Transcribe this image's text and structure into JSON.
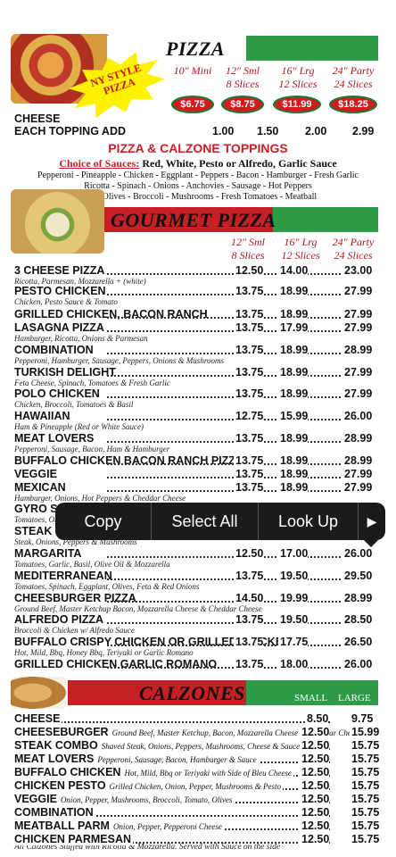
{
  "pizza": {
    "title": "PIZZA",
    "badge": "NY STYLE\nPIZZA",
    "sizes": [
      "10\" Mini",
      "12\" Sml\n8 Slices",
      "16\" Lrg\n12 Slices",
      "24\" Party\n24 Slices"
    ],
    "prices": [
      "$6.75",
      "$8.75",
      "$11.99",
      "$18.25"
    ],
    "cheese_label": "CHEESE",
    "topping_row": {
      "label": "EACH TOPPING ADD",
      "p1": "1.00",
      "p2": "1.50",
      "p3": "2.00",
      "p4": "2.99"
    }
  },
  "toppings": {
    "title": "PIZZA & CALZONE TOPPINGS",
    "sauces_label": "Choice of Sauces:",
    "sauces": "Red, White, Pesto or Alfredo, Garlic Sauce",
    "line1": "Pepperoni - Pineapple - Chicken - Eggplant - Peppers - Bacon - Hamburger - Fresh Garlic",
    "line2": "Ricotta - Spinach - Onions - Anchovies - Sausage - Hot Peppers",
    "line3": "Black Olives - Broccoli - Mushrooms - Fresh Tomatoes - Meatball"
  },
  "gourmet": {
    "title": "GOURMET PIZZA",
    "sizes": [
      "12\" Sml\n8 Slices",
      "16\" Lrg\n12 Slices",
      "24\" Party\n24 Slices"
    ],
    "items": [
      {
        "name": "3 CHEESE PIZZA",
        "desc": "Ricotta, Parmesan, Mozzarella + (white)",
        "p": [
          "12.50",
          "14.00",
          "23.00"
        ]
      },
      {
        "name": "PESTO CHICKEN",
        "desc": "Chicken, Pesto Sauce & Tomato",
        "p": [
          "13.75",
          "18.99",
          "27.99"
        ]
      },
      {
        "name": "GRILLED CHICKEN, BACON RANCH",
        "desc": "",
        "p": [
          "13.75",
          "18.99",
          "27.99"
        ]
      },
      {
        "name": "LASAGNA PIZZA",
        "desc": "Hamburger, Ricotta, Onions & Parmesan",
        "p": [
          "13.75",
          "17.99",
          "27.99"
        ]
      },
      {
        "name": "COMBINATION",
        "desc": "Pepperoni, Hamburger, Sausage, Peppers, Onions & Mushrooms",
        "p": [
          "13.75",
          "18.99",
          "28.99"
        ]
      },
      {
        "name": "TURKISH DELIGHT",
        "desc": "Feta Cheese, Spinach, Tomatoes & Fresh Garlic",
        "p": [
          "13.75",
          "18.99",
          "27.99"
        ]
      },
      {
        "name": "POLO CHICKEN",
        "desc": "Chicken, Broccoli, Tomatoes & Basil",
        "p": [
          "13.75",
          "18.99",
          "27.99"
        ]
      },
      {
        "name": "HAWAIIAN",
        "desc": "Ham & Pineapple (Red or White Sauce)",
        "p": [
          "12.75",
          "15.99",
          "26.00"
        ]
      },
      {
        "name": "MEAT LOVERS",
        "desc": "Pepperoni, Sausage, Bacon, Ham & Hamburger",
        "p": [
          "13.75",
          "18.99",
          "28.99"
        ]
      },
      {
        "name": "BUFFALO CHICKEN BACON RANCH PIZZA",
        "desc": "",
        "p": [
          "13.75",
          "18.99",
          "28.99"
        ]
      },
      {
        "name": "VEGGIE",
        "desc": "",
        "p": [
          "13.75",
          "18.99",
          "27.99"
        ]
      },
      {
        "name": "MEXICAN",
        "desc": "Hamburger, Onions, Hot Peppers & Cheddar Cheese",
        "p": [
          "13.75",
          "18.99",
          "27.99"
        ]
      },
      {
        "name": "GYRO SP",
        "desc": "Tomatoes, On",
        "p": [
          "",
          "",
          ""
        ]
      },
      {
        "name": "STEAK C",
        "desc": "Steak, Onions, Peppers & Mushrooms",
        "p": [
          "",
          "",
          "26.00"
        ]
      },
      {
        "name": "MARGARITA",
        "desc": "Tomatoes, Garlic, Basil, Olive Oil & Mozzarella",
        "p": [
          "12.50",
          "17.00",
          "26.00"
        ]
      },
      {
        "name": "MEDITERRANEAN",
        "desc": "Tomatoes, Spinach, Eggplant, Olives, Feta & Red Onions",
        "p": [
          "13.75",
          "19.50",
          "29.50"
        ]
      },
      {
        "name": "CHEESBURGER PIZZA",
        "desc": "Ground Beef, Master Ketchup Bacon, Mozzarella Cheese & Cheddar Cheese",
        "p": [
          "14.50",
          "19.99",
          "28.99"
        ]
      },
      {
        "name": "ALFREDO PIZZA",
        "desc": "Broccoli & Chicken w/ Alfredo Sauce",
        "p": [
          "13.75",
          "19.50",
          "28.50"
        ]
      },
      {
        "name": "BUFFALO CRISPY CHICKEN OR GRILLED CHICKEN",
        "desc": "Hot, Mild, Bbq, Honey Bbq, Teriyaki or Garlic Romano",
        "p": [
          "13.75",
          "17.75",
          "26.50"
        ]
      },
      {
        "name": "GRILLED CHICKEN GARLIC ROMANO",
        "desc": "",
        "p": [
          "13.75",
          "18.00",
          "26.00"
        ]
      }
    ]
  },
  "calzones": {
    "title": "CALZONES",
    "small": "SMALL",
    "large": "LARGE",
    "items": [
      {
        "name": "CHEESE",
        "desc": "",
        "p": [
          "8.50",
          "9.75"
        ]
      },
      {
        "name": "CHEESEBURGER",
        "desc": "Ground Beef, Master Ketchup, Bacon, Mozzarella Cheese & Cheddar Cheese",
        "p": [
          "12.50",
          "15.99"
        ]
      },
      {
        "name": "STEAK COMBO",
        "desc": "Shaved Steak, Onions, Peppers, Mushrooms, Cheese & Sauce",
        "p": [
          "12.50",
          "15.75"
        ]
      },
      {
        "name": "MEAT LOVERS",
        "desc": "Pepperoni, Sausage, Bacon, Hamburger & Sauce",
        "p": [
          "12.50",
          "15.75"
        ]
      },
      {
        "name": "BUFFALO CHICKEN",
        "desc": "Hot, Mild, Bbq or Teriyaki with Side of Bleu Cheese",
        "p": [
          "12.50",
          "15.75"
        ]
      },
      {
        "name": "CHICKEN PESTO",
        "desc": "Grilled Chicken, Onion, Pepper, Mushrooms & Pesto",
        "p": [
          "12.50",
          "15.75"
        ]
      },
      {
        "name": "VEGGIE",
        "desc": "Onion, Pepper, Mushrooms, Broccoli, Tomato, Olives",
        "p": [
          "12.50",
          "15.75"
        ]
      },
      {
        "name": "COMBINATION",
        "desc": "",
        "p": [
          "12.50",
          "15.75"
        ]
      },
      {
        "name": "MEATBALL PARM",
        "desc": "Onion, Pepper, Pepperoni Cheese",
        "p": [
          "12.50",
          "15.75"
        ]
      },
      {
        "name": "CHICKEN PARMESAN",
        "desc": "",
        "p": [
          "12.50",
          "15.75"
        ]
      }
    ],
    "footer": "All Calzones Stuffed with Ricotta & Mozzarella. Served with Sauce on the side"
  },
  "context_menu": {
    "copy": "Copy",
    "select_all": "Select All",
    "look_up": "Look Up",
    "more_icon": "play-arrow-icon"
  },
  "colors": {
    "red": "#c62026",
    "green": "#2e9b48",
    "badge_yellow": "#fff200"
  }
}
